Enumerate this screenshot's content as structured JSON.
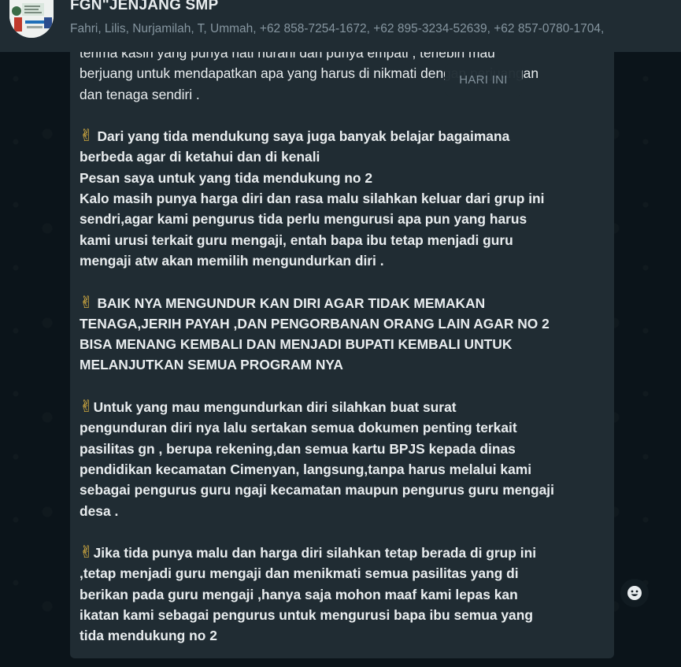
{
  "header": {
    "title": "FGN\"JENJANG SMP",
    "members": "Fahri, Lilis, Nurjamilah, T, Ummah, +62 858-7254-1672, +62 895-3234-52639, +62 857-0780-1704,",
    "avatar_icon": "group-avatar-icon"
  },
  "chat": {
    "date_chip": "HARI INI",
    "message": {
      "p1": [
        "terima kasih yang punya hati nurani dan punya empati , terlebih mau",
        "berjuang untuk mendapatkan apa yang harus di nikmati dengan perjuangan",
        "dan tenaga sendiri ."
      ],
      "p2": [
        "Dari yang tida mendukung saya juga banyak belajar bagaimana",
        "berbeda agar di ketahui dan di kenali",
        "Pesan saya untuk yang tida mendukung no 2",
        "Kalo masih punya harga diri dan rasa malu silahkan keluar dari grup ini",
        "sendri,agar kami pengurus tida perlu mengurusi apa pun yang harus",
        "kami urusi terkait guru mengaji, entah bapa ibu tetap menjadi guru",
        "mengaji atw akan memilih mengundurkan diri ."
      ],
      "p3": [
        "BAIK NYA MENGUNDUR KAN DIRI AGAR TIDAK MEMAKAN",
        "TENAGA,JERIH PAYAH ,DAN PENGORBANAN ORANG LAIN AGAR NO 2",
        "BISA MENANG KEMBALI DAN MENJADI BUPATI KEMBALI UNTUK",
        "MELANJUTKAN SEMUA PROGRAM NYA"
      ],
      "p4": [
        "Untuk yang mau mengundurkan diri silahkan buat surat",
        "pengunduran diri nya lalu sertakan semua dokumen penting terkait",
        "pasilitas gn , berupa rekening,dan semua kartu BPJS kepada dinas",
        "pendidikan kecamatan Cimenyan, langsung,tanpa harus melalui kami",
        "sebagai pengurus guru ngaji kecamatan maupun pengurus guru mengaji",
        "desa ."
      ],
      "p5": [
        "Jika tida punya malu dan harga diri silahkan tetap berada di grup ini",
        ",tetap menjadi guru  mengaji dan menikmati semua pasilitas yang di",
        "berikan pada guru mengaji  ,hanya saja mohon maaf kami lepas kan",
        "ikatan kami sebagai pengurus untuk mengurusi bapa ibu semua yang",
        "tida mendukung no 2"
      ],
      "emoji": "✌"
    },
    "emoji_button_icon": "smiley-icon"
  },
  "colors": {
    "bubble": "#202c33",
    "text": "#e9edef",
    "subtext": "#8696a0",
    "background": "#0b141a"
  }
}
